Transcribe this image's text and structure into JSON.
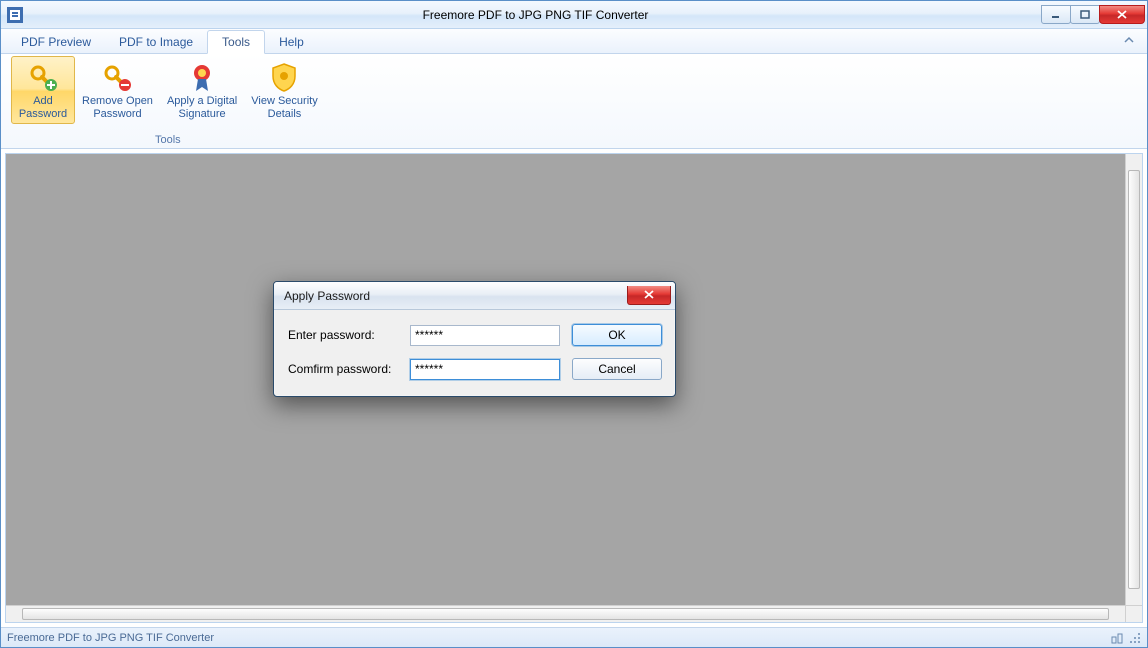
{
  "app": {
    "title": "Freemore PDF to JPG PNG TIF Converter",
    "status": "Freemore PDF to JPG PNG TIF Converter"
  },
  "tabs": {
    "items": [
      {
        "label": "PDF Preview"
      },
      {
        "label": "PDF to Image"
      },
      {
        "label": "Tools"
      },
      {
        "label": "Help"
      }
    ],
    "active_index": 2
  },
  "ribbon": {
    "group_label": "Tools",
    "buttons": [
      {
        "line1": "Add",
        "line2": "Password",
        "name": "add-password",
        "selected": true
      },
      {
        "line1": "Remove Open",
        "line2": "Password",
        "name": "remove-open-password",
        "selected": false
      },
      {
        "line1": "Apply a Digital",
        "line2": "Signature",
        "name": "apply-digital-signature",
        "selected": false
      },
      {
        "line1": "View Security",
        "line2": "Details",
        "name": "view-security-details",
        "selected": false
      }
    ]
  },
  "dialog": {
    "title": "Apply Password",
    "enter_label": "Enter password:",
    "confirm_label": "Comfirm password:",
    "enter_value": "******",
    "confirm_value": "******",
    "ok_label": "OK",
    "cancel_label": "Cancel"
  }
}
